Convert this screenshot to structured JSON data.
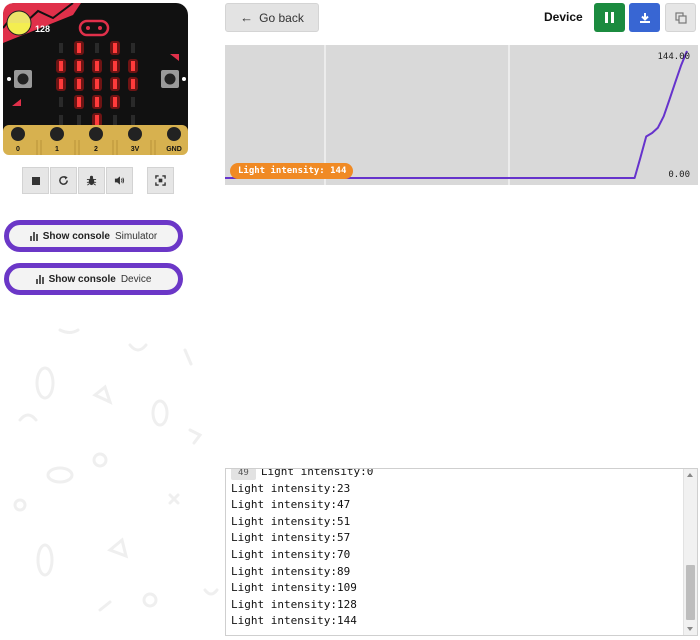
{
  "simulator": {
    "light_level": "128",
    "pins": [
      "0",
      "1",
      "2",
      "3V",
      "GND"
    ],
    "button_a": "A",
    "button_b": "B",
    "led_matrix": [
      [
        0,
        1,
        0,
        1,
        0
      ],
      [
        1,
        1,
        1,
        1,
        1
      ],
      [
        1,
        1,
        1,
        1,
        1
      ],
      [
        0,
        1,
        1,
        1,
        0
      ],
      [
        0,
        0,
        1,
        0,
        0
      ]
    ]
  },
  "controls": [
    "stop-icon",
    "restart-icon",
    "debug-icon",
    "mute-icon",
    "fullscreen-icon"
  ],
  "console_buttons": [
    {
      "label": "Show console",
      "target": "Simulator"
    },
    {
      "label": "Show console",
      "target": "Device"
    }
  ],
  "header": {
    "back_label": "Go back",
    "title": "Device"
  },
  "chart_data": {
    "type": "line",
    "title": "",
    "series": [
      {
        "name": "Light intensity: 144",
        "values": [
          0,
          0,
          0,
          0,
          0,
          0,
          0,
          0,
          0,
          0,
          0,
          0,
          0,
          0,
          0,
          0,
          0,
          0,
          0,
          0,
          0,
          0,
          0,
          0,
          0,
          0,
          0,
          0,
          0,
          0,
          0,
          0,
          0,
          0,
          0,
          0,
          0,
          0,
          0,
          0,
          0,
          0,
          0,
          0,
          0,
          0,
          0,
          0,
          0,
          23,
          47,
          51,
          57,
          70,
          89,
          109,
          128,
          144
        ]
      }
    ],
    "y_max_label": "144.00",
    "y_min_label": "0.00",
    "ylim": [
      0,
      144
    ],
    "grid": true,
    "line_color": "#6633cc",
    "badge_color": "#f08a24"
  },
  "console": {
    "first_line": {
      "count": "49",
      "text": "Light intensity:0"
    },
    "lines": [
      "Light intensity:23",
      "Light intensity:47",
      "Light intensity:51",
      "Light intensity:57",
      "Light intensity:70",
      "Light intensity:89",
      "Light intensity:109",
      "Light intensity:128",
      "Light intensity:144"
    ]
  },
  "colors": {
    "accent_purple": "#6b37c7",
    "pause_green": "#1b8b3f",
    "download_blue": "#3866d3"
  }
}
